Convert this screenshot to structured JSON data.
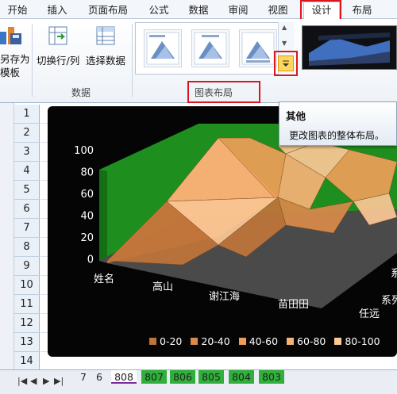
{
  "ribbon_tabs": [
    "开始",
    "插入",
    "页面布局",
    "公式",
    "数据",
    "审阅",
    "视图",
    "设计",
    "布局"
  ],
  "ribbon": {
    "save_as_template": [
      "另存为",
      "模板"
    ],
    "switch_row_col": "切换行/列",
    "select_data": "选择数据",
    "group_data": "数据",
    "group_chart_layout": "图表布局"
  },
  "tooltip": {
    "title": "其他",
    "body": "更改图表的整体布局。"
  },
  "row_numbers": [
    "1",
    "2",
    "3",
    "4",
    "5",
    "6",
    "7",
    "8",
    "9",
    "10",
    "11",
    "12",
    "13",
    "14"
  ],
  "chart_data": {
    "type": "3d-surface",
    "z_ticks": [
      "100",
      "80",
      "60",
      "40",
      "20",
      "0"
    ],
    "categories": [
      "姓名",
      "高山",
      "谢江海",
      "苗田田",
      "任远"
    ],
    "depth_labels": [
      "系列",
      "系"
    ],
    "legend": [
      "0-20",
      "20-40",
      "40-60",
      "60-80",
      "80-100"
    ],
    "colors": [
      "#c0743a",
      "#d98a4a",
      "#ee9e58",
      "#f7b276",
      "#fcc896"
    ]
  },
  "sheet_tabs": {
    "labels": [
      "7",
      "6",
      "808",
      "807",
      "806",
      "805",
      "804",
      "803"
    ],
    "active": "808"
  },
  "colors": {
    "highlight_red": "#e0141e",
    "wall_green": "#1e8f1e",
    "floor_gray": "#4a4a4a",
    "sheet_tab_green": "#2fb03a"
  }
}
